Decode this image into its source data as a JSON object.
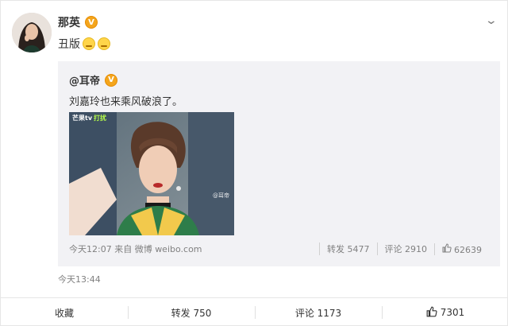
{
  "post": {
    "author": "那英",
    "verified_badge": "V",
    "text": "丑版",
    "emojis": [
      "smirk-emoji",
      "smirk-emoji"
    ],
    "time": "今天13:44"
  },
  "repost": {
    "author": "@耳帝",
    "verified_badge": "V",
    "text": "刘嘉玲也来乘风破浪了。",
    "photo_logo": [
      "芒果tv",
      "打扰"
    ],
    "photo_watermark": "@耳帝",
    "footer": {
      "time_source": "今天12:07 来自 微博 weibo.com",
      "repost": "转发 5477",
      "comment": "评论 2910",
      "like": "62639"
    }
  },
  "actions": {
    "favorite": "收藏",
    "repost": "转发 750",
    "comment": "评论 1173",
    "like": "7301"
  },
  "colors": {
    "verified": "#f4a51c",
    "repost_bg": "#f2f2f5",
    "muted_text": "#808080"
  }
}
